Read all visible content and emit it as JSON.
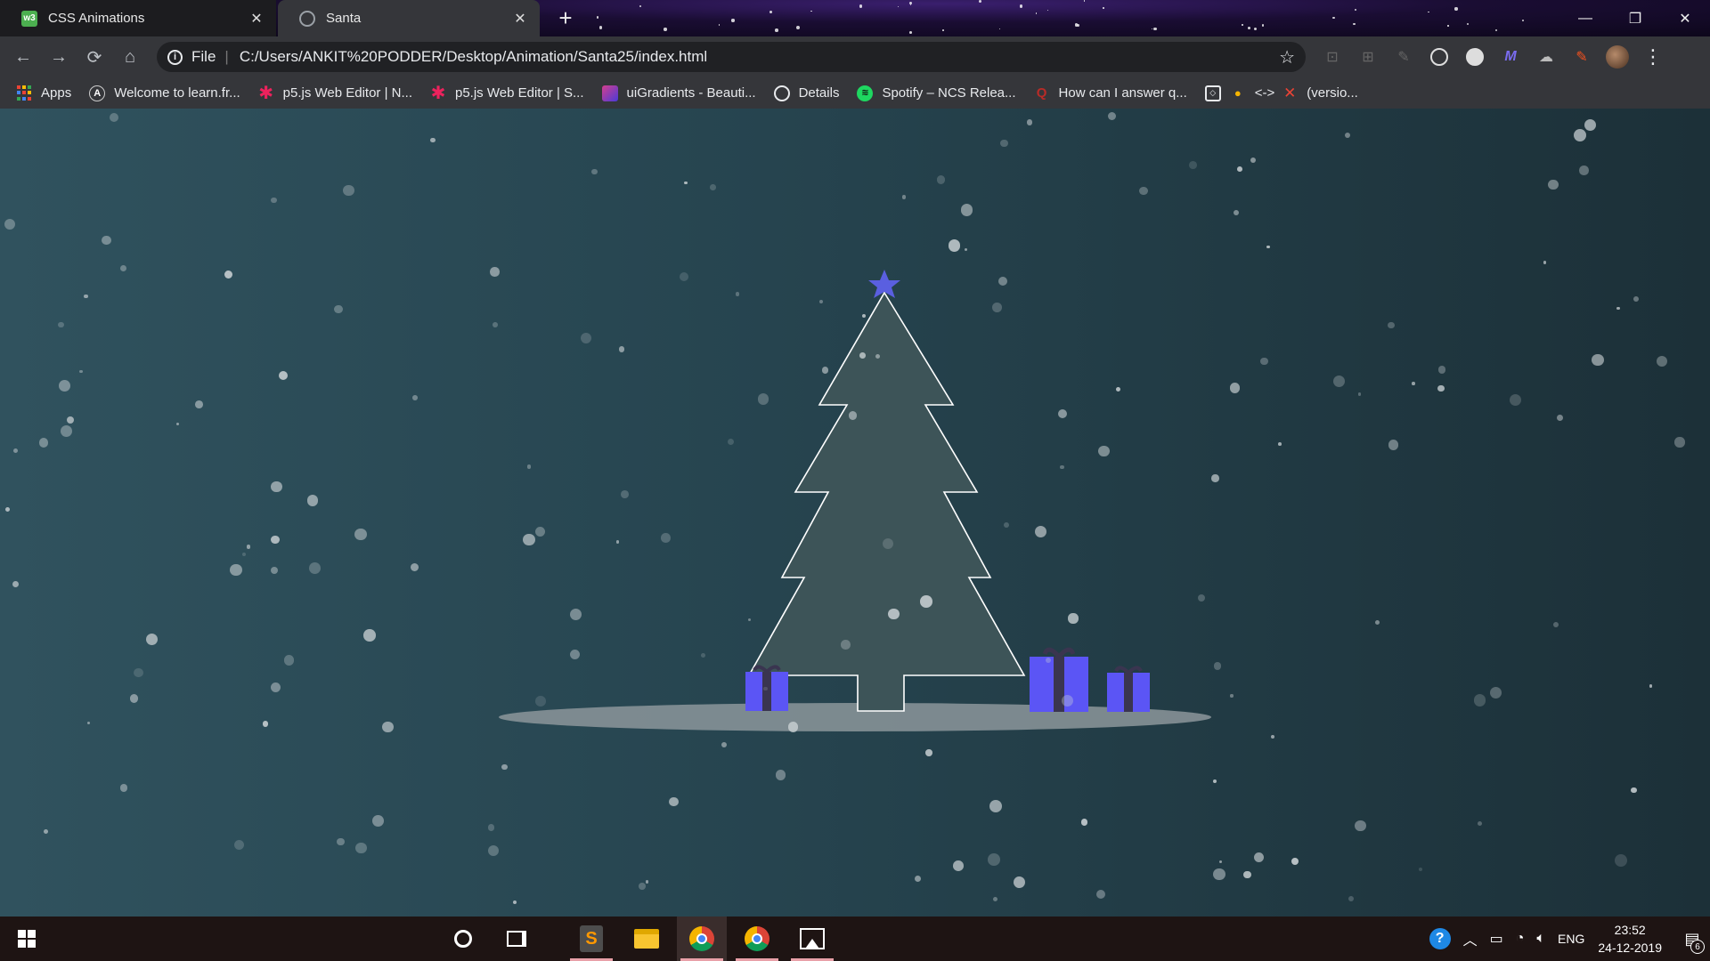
{
  "browser": {
    "tabs": [
      {
        "title": "CSS Animations",
        "favicon": "w3schools-icon",
        "active": false
      },
      {
        "title": "Santa",
        "favicon": "globe-icon",
        "active": true
      }
    ],
    "new_tab_glyph": "+",
    "window_controls": {
      "minimize": "—",
      "restore": "❐",
      "close": "✕"
    },
    "toolbar": {
      "back": "←",
      "forward": "→",
      "reload": "⟳",
      "home": "⌂",
      "info_glyph": "i",
      "scheme_label": "File",
      "url": "C:/Users/ANKIT%20PODDER/Desktop/Animation/Santa25/index.html",
      "bookmark_star": "☆",
      "menu_glyph": "⋮"
    },
    "bookmarks": [
      {
        "label": "Apps",
        "icon": "apps-grid-icon"
      },
      {
        "label": "Welcome to learn.fr...",
        "icon": "learn-icon"
      },
      {
        "label": "p5.js Web Editor | N...",
        "icon": "p5js-icon"
      },
      {
        "label": "p5.js Web Editor | S...",
        "icon": "p5js-icon"
      },
      {
        "label": "uiGradients - Beauti...",
        "icon": "uigradients-icon"
      },
      {
        "label": "Details",
        "icon": "globe-icon"
      },
      {
        "label": "Spotify – NCS Relea...",
        "icon": "spotify-icon"
      },
      {
        "label": "How can I answer q...",
        "icon": "quora-icon"
      },
      {
        "label": "<->",
        "icon": "codepen-icon"
      },
      {
        "label": "(versio...",
        "icon": "close-x-icon"
      }
    ]
  },
  "scene": {
    "tree_fill": "#3d5458",
    "tree_stroke": "#ffffff",
    "star_color": "#5a5fe0",
    "present_color": "#5b55f5",
    "ribbon_color": "#3a3550",
    "ground_color": "#8c979b"
  },
  "taskbar": {
    "apps": [
      "cortana-icon",
      "task-view-icon",
      "sublime-text-icon",
      "file-explorer-icon",
      "chrome-icon",
      "chrome-icon",
      "photos-icon"
    ],
    "tray": {
      "help_glyph": "?",
      "language": "ENG",
      "time": "23:52",
      "date": "24-12-2019",
      "notification_count": "6"
    }
  }
}
